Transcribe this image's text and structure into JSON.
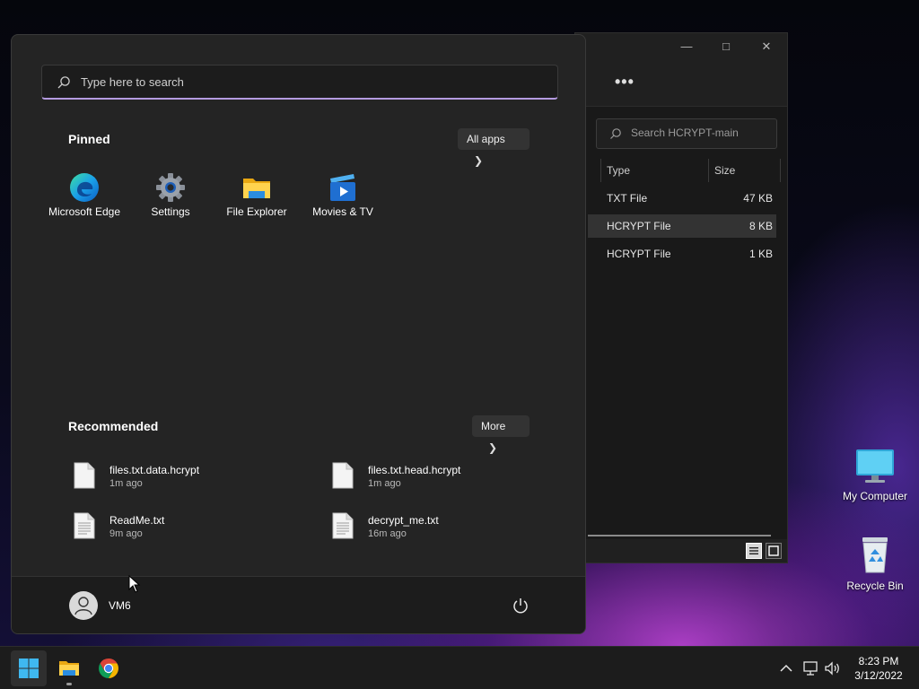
{
  "explorer": {
    "search_placeholder": "Search HCRYPT-main",
    "columns": [
      "Type",
      "Size"
    ],
    "rows": [
      {
        "type": "TXT File",
        "size": "47 KB"
      },
      {
        "type": "HCRYPT File",
        "size": "8 KB"
      },
      {
        "type": "HCRYPT File",
        "size": "1 KB"
      }
    ]
  },
  "start_menu": {
    "search_placeholder": "Type here to search",
    "pinned_title": "Pinned",
    "all_apps_label": "All apps",
    "pinned": [
      {
        "label": "Microsoft Edge",
        "icon": "edge-icon"
      },
      {
        "label": "Settings",
        "icon": "settings-gear-icon"
      },
      {
        "label": "File Explorer",
        "icon": "folder-icon"
      },
      {
        "label": "Movies & TV",
        "icon": "movies-tv-icon"
      }
    ],
    "recommended_title": "Recommended",
    "more_label": "More",
    "recommended": [
      {
        "name": "files.txt.data.hcrypt",
        "time": "1m ago"
      },
      {
        "name": "files.txt.head.hcrypt",
        "time": "1m ago"
      },
      {
        "name": "ReadMe.txt",
        "time": "9m ago"
      },
      {
        "name": "decrypt_me.txt",
        "time": "16m ago"
      }
    ],
    "user": "VM6"
  },
  "desktop": {
    "icons": [
      {
        "label": "My Computer",
        "icon": "monitor-icon"
      },
      {
        "label": "Recycle Bin",
        "icon": "recycle-bin-icon"
      }
    ]
  },
  "taskbar": {
    "time": "8:23 PM",
    "date": "3/12/2022"
  },
  "colors": {
    "accent": "#b49adf",
    "start_bg": "#242424",
    "taskbar_bg": "#1c1c1c"
  }
}
